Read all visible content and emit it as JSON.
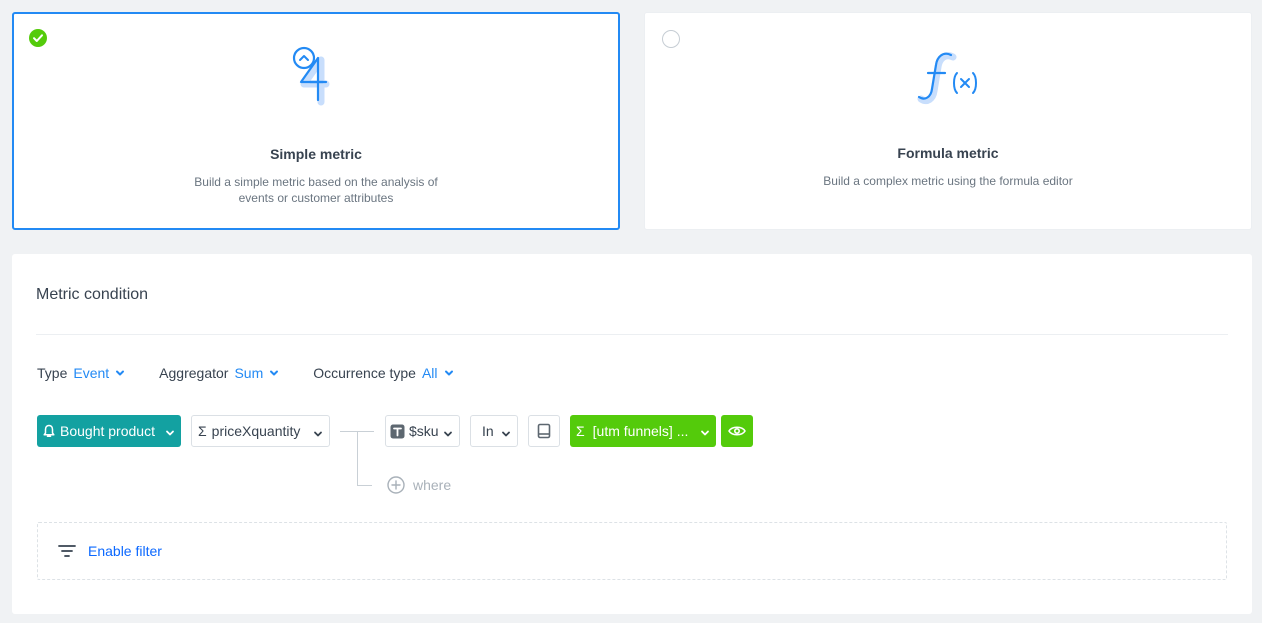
{
  "cards": {
    "simple": {
      "title": "Simple metric",
      "description_line1": "Build a simple metric based on the analysis of",
      "description_line2": "events or customer attributes",
      "selected": true
    },
    "formula": {
      "title": "Formula metric",
      "description": "Build a complex metric using the formula editor",
      "selected": false
    }
  },
  "condition": {
    "title": "Metric condition",
    "type": {
      "label": "Type",
      "value": "Event"
    },
    "aggregator": {
      "label": "Aggregator",
      "value": "Sum"
    },
    "occurrence": {
      "label": "Occurrence type",
      "value": "All"
    },
    "event_pill": "Bought product",
    "param_pill": "priceXquantity",
    "param_symbol": "Σ",
    "sku_pill": "$sku",
    "operator_pill": "In",
    "aggregate_pill": "[utm funnels] ...",
    "aggregate_symbol": "Σ",
    "where_label": "where",
    "enable_filter": "Enable filter"
  },
  "colors": {
    "accent_blue": "#238af4",
    "teal": "#13a1a1",
    "green": "#54cb0b",
    "link_blue": "#0b68ff"
  },
  "icons": {
    "simple_card": "simple-metric-icon",
    "formula_card": "formula-icon",
    "event": "bell-icon",
    "sku": "text-type-icon",
    "book": "catalog-icon",
    "eye": "eye-icon",
    "where": "plus-circle-icon",
    "filter": "filter-icon"
  }
}
